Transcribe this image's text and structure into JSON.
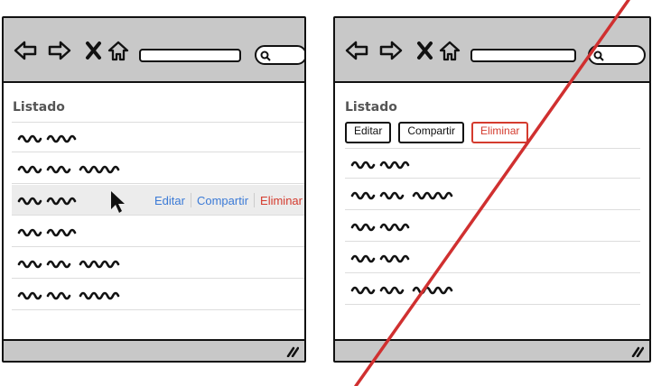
{
  "left": {
    "title": "Listado",
    "rows": [
      {
        "scribble_words": 2
      },
      {
        "scribble_words": 3
      },
      {
        "scribble_words": 2,
        "selected": true
      },
      {
        "scribble_words": 2
      },
      {
        "scribble_words": 3
      },
      {
        "scribble_words": 3
      }
    ],
    "actions": {
      "edit": "Editar",
      "share": "Compartir",
      "delete": "Eliminar"
    }
  },
  "right": {
    "title": "Listado",
    "buttons": {
      "edit": "Editar",
      "share": "Compartir",
      "delete": "Eliminar"
    },
    "rows": [
      {
        "scribble_words": 2
      },
      {
        "scribble_words": 3
      },
      {
        "scribble_words": 2
      },
      {
        "scribble_words": 2
      },
      {
        "scribble_words": 3
      }
    ],
    "crossed_out": true
  },
  "colors": {
    "accent_link": "#3b7ad6",
    "danger": "#d43b2e",
    "crossout": "#d03030"
  },
  "icons": [
    "back-arrow-icon",
    "forward-arrow-icon",
    "close-x-icon",
    "home-icon",
    "search-icon",
    "resize-grip-icon",
    "mouse-pointer-icon"
  ]
}
